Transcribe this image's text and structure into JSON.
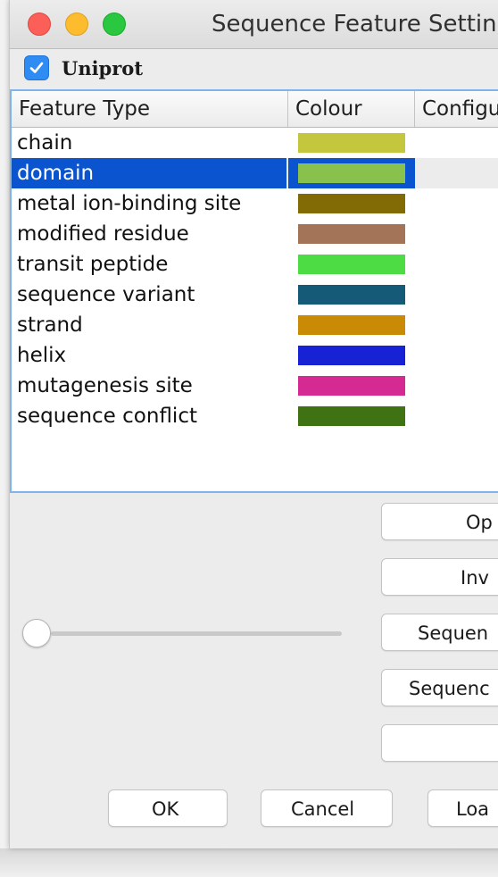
{
  "window": {
    "title": "Sequence Feature Settin"
  },
  "group": {
    "label": "Uniprot",
    "checked": true
  },
  "table": {
    "headers": [
      "Feature Type",
      "Colour",
      "Configu"
    ],
    "rows": [
      {
        "name": "chain",
        "colour": "#c4c73e"
      },
      {
        "name": "domain",
        "colour": "#88c24c",
        "selected": true
      },
      {
        "name": "metal ion-binding site",
        "colour": "#826a05"
      },
      {
        "name": "modified residue",
        "colour": "#a37457"
      },
      {
        "name": "transit peptide",
        "colour": "#4ddc43"
      },
      {
        "name": "sequence variant",
        "colour": "#155b78"
      },
      {
        "name": "strand",
        "colour": "#c98b06"
      },
      {
        "name": "helix",
        "colour": "#1622d3"
      },
      {
        "name": "mutagenesis site",
        "colour": "#d42a92"
      },
      {
        "name": "sequence conflict",
        "colour": "#3f7213"
      }
    ]
  },
  "side_buttons": [
    "Op",
    "Inv",
    "Sequen",
    "Sequenc",
    ""
  ],
  "bottom_buttons": {
    "ok": "OK",
    "cancel": "Cancel",
    "load": "Loa"
  },
  "slider": {
    "value": 0
  },
  "colors": {
    "selection": "#0a55cf",
    "checkbox": "#2f8cf2",
    "table_border": "#7fb4ec"
  }
}
